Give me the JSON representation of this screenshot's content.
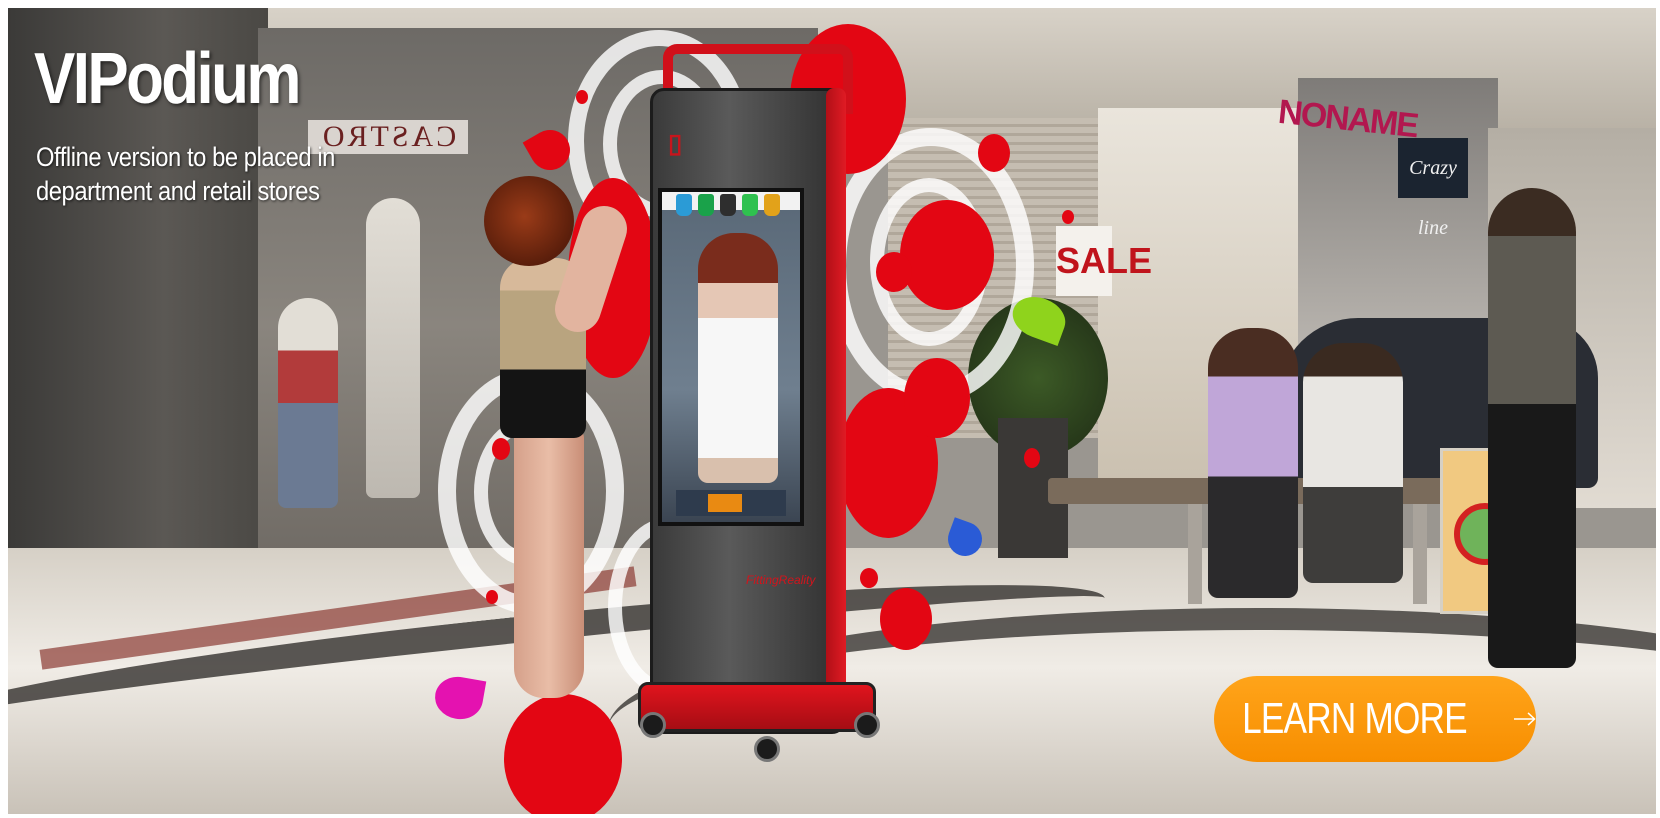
{
  "banner": {
    "title": "VIPodium",
    "subtitle": "Offline version to be placed in department and retail stores",
    "cta_label": "LEARN MORE",
    "cta_icon": "arrow-right-icon"
  },
  "scene": {
    "store_signs": [
      "CASTRO",
      "SALE",
      "NONAME",
      "Crazy line"
    ],
    "kiosk_brand": "FittingReality"
  },
  "colors": {
    "accent_red": "#e30613",
    "cta_orange": "#f78e00",
    "text": "#ffffff"
  }
}
